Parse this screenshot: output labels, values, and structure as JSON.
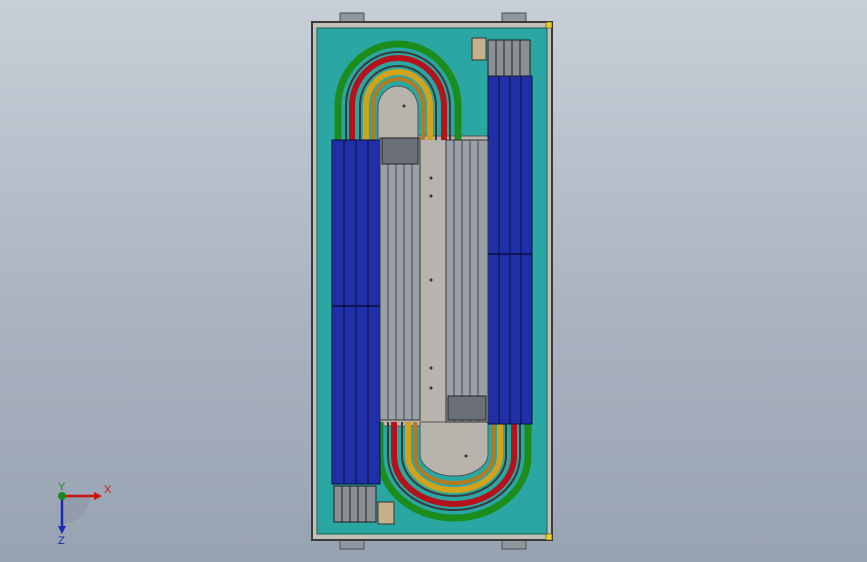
{
  "viewport": {
    "background_top": "#c9cfd8",
    "background_bottom": "#98a3b2"
  },
  "triad": {
    "x_label": "X",
    "y_label": "Y",
    "z_label": "Z",
    "x_color": "#c81414",
    "y_color": "#1a8a1a",
    "z_color": "#1a2ab8"
  },
  "model": {
    "frame_color": "#2aa7a3",
    "track_colors": [
      "#1c8c1c",
      "#b5121b",
      "#d2a21a",
      "#b67a1e"
    ],
    "conveyor_color": "#1f2fa8",
    "rail_color": "#9aa0a8",
    "deck_color": "#b7b4ad"
  }
}
